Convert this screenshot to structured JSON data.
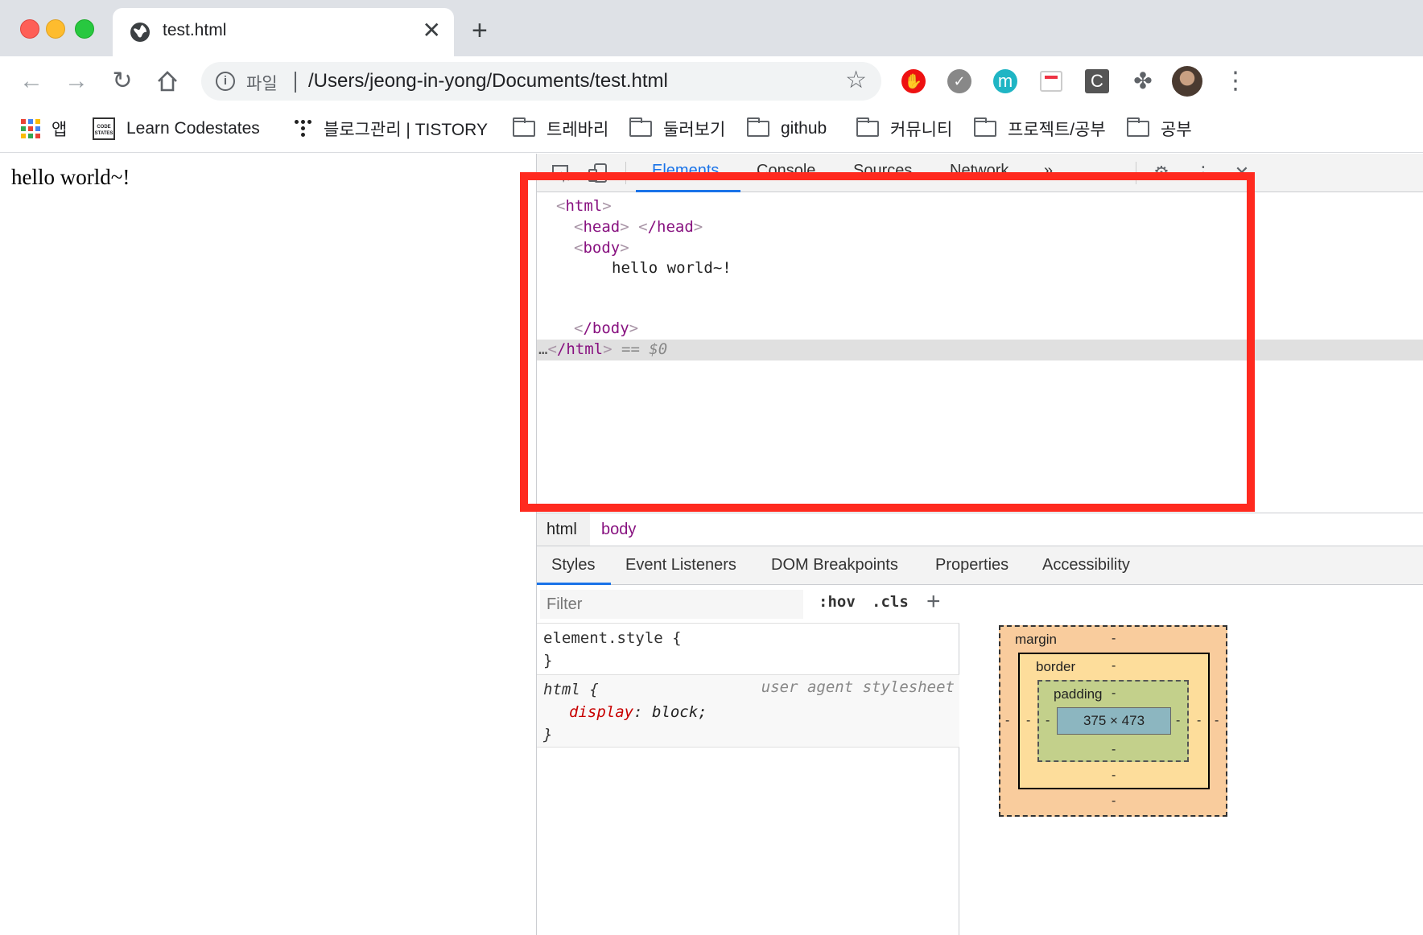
{
  "tab": {
    "title": "test.html"
  },
  "omnibox": {
    "scheme_label": "파일",
    "url": "/Users/jeong-in-yong/Documents/test.html"
  },
  "bookmarks": {
    "apps": "앱",
    "codestates": "Learn Codestates",
    "tistory": "블로그관리 | TISTORY",
    "folders": [
      "트레바리",
      "둘러보기",
      "github",
      "커뮤니티",
      "프로젝트/공부",
      "공부"
    ]
  },
  "page": {
    "text": "hello world~!"
  },
  "devtools": {
    "tabs": [
      "Elements",
      "Console",
      "Sources",
      "Network",
      "»"
    ],
    "tree": {
      "html_open": "html",
      "head_open": "head",
      "head_close": "/head",
      "body_open": "body",
      "body_text": "hello world~!",
      "body_close": "/body",
      "html_close": "/html",
      "selected_suffix": " == ",
      "dollar": "$0"
    },
    "breadcrumb": [
      "html",
      "body"
    ],
    "sub_tabs": [
      "Styles",
      "Event Listeners",
      "DOM Breakpoints",
      "Properties",
      "Accessibility"
    ],
    "filter_placeholder": "Filter",
    "hov": ":hov",
    "cls": ".cls",
    "rules": {
      "element_style": "element.style {",
      "close": "}",
      "html_selector": "html {",
      "ua_label": "user agent stylesheet",
      "prop": "display",
      "val": "block;"
    },
    "boxmodel": {
      "margin": "margin",
      "border": "border",
      "padding": "padding",
      "dash": "-",
      "content": "375 × 473"
    }
  },
  "colors": {
    "highlight": "#ff2a1f",
    "active_tab": "#1a73e8"
  }
}
